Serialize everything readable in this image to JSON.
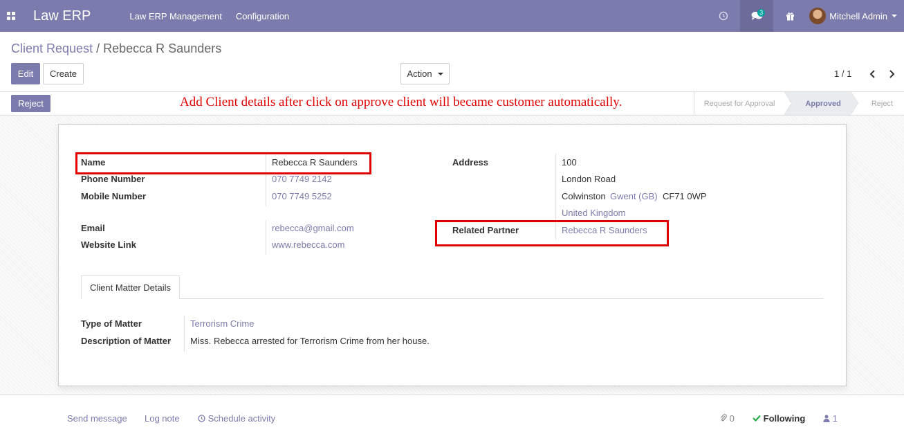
{
  "navbar": {
    "brand": "Law ERP",
    "menu": [
      "Law ERP Management",
      "Configuration"
    ],
    "messages_count": "3",
    "user_name": "Mitchell Admin"
  },
  "breadcrumb": {
    "parent": "Client Request",
    "separator": "/",
    "current": "Rebecca R Saunders"
  },
  "controls": {
    "edit": "Edit",
    "create": "Create",
    "action": "Action",
    "pager": "1 / 1"
  },
  "statusbar": {
    "reject_button": "Reject",
    "note": "Add Client details after click on approve client will became customer automatically.",
    "stages": [
      "Request for Approval",
      "Approved",
      "Reject"
    ],
    "current_stage": "Approved"
  },
  "form": {
    "name_label": "Name",
    "name_value": "Rebecca R Saunders",
    "phone_label": "Phone Number",
    "phone_value": "070 7749 2142",
    "mobile_label": "Mobile Number",
    "mobile_value": "070 7749 5252",
    "email_label": "Email",
    "email_value": "rebecca@gmail.com",
    "website_label": "Website Link",
    "website_value": "www.rebecca.com",
    "address_label": "Address",
    "address_street": "100",
    "address_street2": "London Road",
    "address_city": "Colwinston",
    "address_state": "Gwent (GB)",
    "address_zip": "CF71 0WP",
    "address_country": "United Kingdom",
    "partner_label": "Related Partner",
    "partner_value": "Rebecca R Saunders"
  },
  "tabs": {
    "matter": "Client Matter Details"
  },
  "matter": {
    "type_label": "Type of Matter",
    "type_value": "Terrorism Crime",
    "desc_label": "Description of Matter",
    "desc_value": "Miss. Rebecca arrested for Terrorism Crime from her house."
  },
  "chatter": {
    "send_message": "Send message",
    "log_note": "Log note",
    "schedule": "Schedule activity",
    "attachments": "0",
    "following": "Following",
    "followers": "1"
  },
  "colors": {
    "brand": "#7c7bad",
    "annotation": "#e00000"
  }
}
